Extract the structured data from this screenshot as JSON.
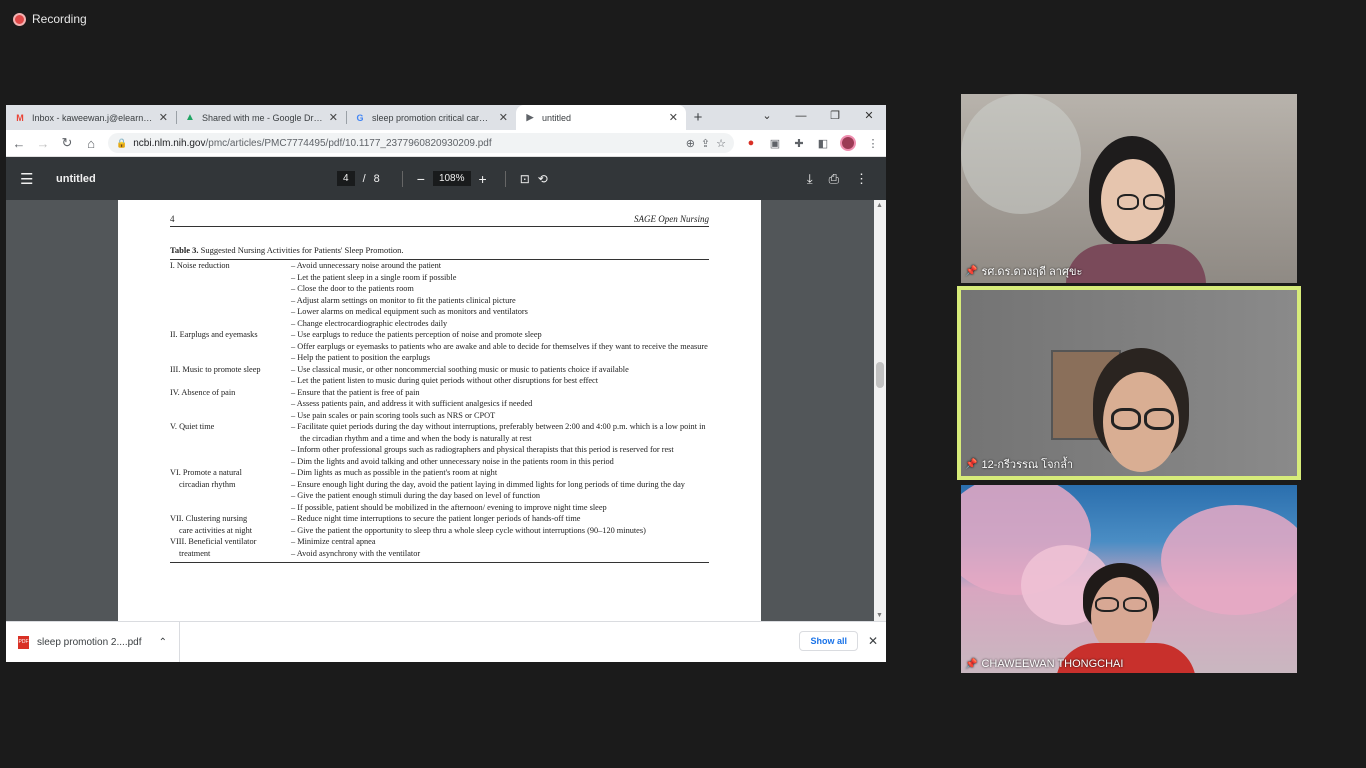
{
  "recording": {
    "label": "Recording"
  },
  "browser": {
    "tabs": [
      {
        "title": "Inbox - kaweewan.j@elearning",
        "icon": "gmail-icon"
      },
      {
        "title": "Shared with me - Google Drive",
        "icon": "drive-icon"
      },
      {
        "title": "sleep promotion critical care C",
        "icon": "google-icon"
      },
      {
        "title": "untitled",
        "icon": "doc-icon"
      }
    ],
    "url_host": "ncbi.nlm.nih.gov",
    "url_path": "/pmc/articles/PMC7774495/pdf/10.1177_2377960820930209.pdf"
  },
  "pdf": {
    "title": "untitled",
    "page_current": "4",
    "page_sep": "/",
    "page_total": "8",
    "zoom": "108%"
  },
  "document": {
    "page_number": "4",
    "journal": "SAGE Open Nursing",
    "table_label": "Table 3.",
    "table_caption": "Suggested Nursing Activities for Patients' Sleep Promotion.",
    "rows": [
      {
        "c1": "I. Noise reduction",
        "c1_indent": false,
        "c2": "– Avoid unnecessary noise around the patient"
      },
      {
        "c1": "",
        "c1_indent": false,
        "c2": "– Let the patient sleep in a single room if possible"
      },
      {
        "c1": "",
        "c1_indent": false,
        "c2": "– Close the door to the patients room"
      },
      {
        "c1": "",
        "c1_indent": false,
        "c2": "– Adjust alarm settings on monitor to fit the patients clinical picture"
      },
      {
        "c1": "",
        "c1_indent": false,
        "c2": "– Lower alarms on medical equipment such as monitors and ventilators"
      },
      {
        "c1": "",
        "c1_indent": false,
        "c2": "– Change electrocardiographic electrodes daily"
      },
      {
        "c1": "II. Earplugs and eyemasks",
        "c1_indent": false,
        "c2": "– Use earplugs to reduce the patients perception of noise and promote sleep"
      },
      {
        "c1": "",
        "c1_indent": false,
        "c2": "– Offer earplugs or eyemasks to patients who are awake and able to decide for themselves if they want to receive the measure"
      },
      {
        "c1": "",
        "c1_indent": false,
        "c2": "– Help the patient to position the earplugs"
      },
      {
        "c1": "III. Music to promote sleep",
        "c1_indent": false,
        "c2": "– Use classical music, or other noncommercial soothing music or music to patients choice if available"
      },
      {
        "c1": "",
        "c1_indent": false,
        "c2": "– Let the patient listen to music during quiet periods without other disruptions for best effect"
      },
      {
        "c1": "IV. Absence of pain",
        "c1_indent": false,
        "c2": "– Ensure that the patient is free of pain"
      },
      {
        "c1": "",
        "c1_indent": false,
        "c2": "– Assess patients pain, and address it with sufficient analgesics if needed"
      },
      {
        "c1": "",
        "c1_indent": false,
        "c2": "– Use pain scales or pain scoring tools such as NRS or CPOT"
      },
      {
        "c1": "V. Quiet time",
        "c1_indent": false,
        "c2": "– Facilitate quiet periods during the day without interruptions, preferably between 2:00 and 4:00 p.m. which is a low point in the circadian rhythm and a time and when the body is naturally at rest"
      },
      {
        "c1": "",
        "c1_indent": false,
        "c2": "– Inform other professional groups such as radiographers and physical therapists that this period is reserved for rest"
      },
      {
        "c1": "",
        "c1_indent": false,
        "c2": "– Dim the lights and avoid talking and other unnecessary noise in the patients room in this period"
      },
      {
        "c1": "VI. Promote a natural",
        "c1_indent": false,
        "c2": "– Dim lights as much as possible in the patient's room at night"
      },
      {
        "c1": "circadian rhythm",
        "c1_indent": true,
        "c2": "– Ensure enough light during the day, avoid the patient laying in dimmed lights for long periods of time during the day"
      },
      {
        "c1": "",
        "c1_indent": false,
        "c2": "– Give the patient enough stimuli during the day based on level of function"
      },
      {
        "c1": "",
        "c1_indent": false,
        "c2": "– If possible, patient should be mobilized in the afternoon/ evening to improve night time sleep"
      },
      {
        "c1": "VII. Clustering nursing",
        "c1_indent": false,
        "c2": "– Reduce night time interruptions to secure the patient longer periods of hands-off time"
      },
      {
        "c1": "care activities at night",
        "c1_indent": true,
        "c2": "– Give the patient the opportunity to sleep thru a whole sleep cycle without interruptions (90–120 minutes)"
      },
      {
        "c1": "VIII. Beneficial ventilator",
        "c1_indent": false,
        "c2": "– Minimize central apnea"
      },
      {
        "c1": "treatment",
        "c1_indent": true,
        "c2": "– Avoid asynchrony with the ventilator"
      }
    ]
  },
  "downloads": {
    "file": "sleep promotion 2....pdf",
    "show_all": "Show all"
  },
  "participants": [
    {
      "name": "รศ.ดร.ดวงฤดี ลาศุขะ"
    },
    {
      "name": "12-กรีวรรณ โจกล้ำ"
    },
    {
      "name": "CHAWEEWAN THONGCHAI"
    }
  ],
  "colors": {
    "active_speaker_border": "#d7ec7a",
    "pdf_toolbar": "#323639",
    "recording_dot": "#e04848"
  }
}
